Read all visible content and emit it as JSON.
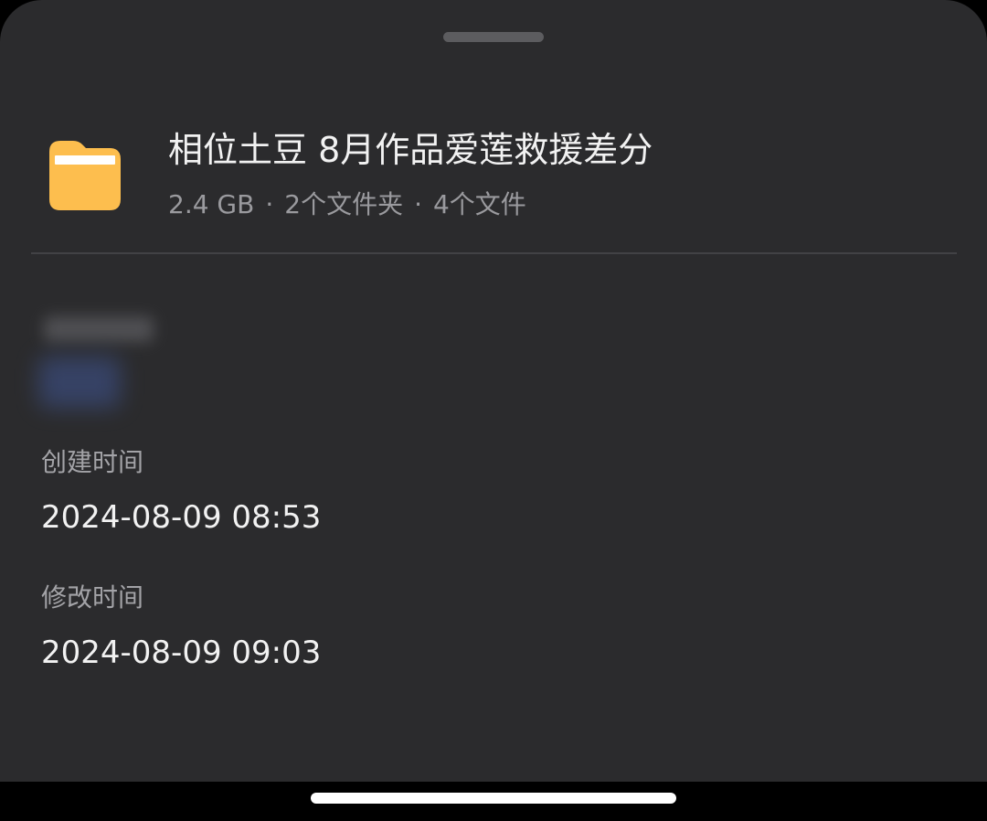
{
  "folder": {
    "icon": "folder-icon",
    "icon_color": "#FDBE4E",
    "name": "相位土豆 8月作品爱莲救援差分",
    "size": "2.4 GB",
    "separator": "·",
    "subfolders": "2个文件夹",
    "files": "4个文件"
  },
  "details": {
    "created_label": "创建时间",
    "created_value": "2024-08-09 08:53",
    "modified_label": "修改时间",
    "modified_value": "2024-08-09 09:03"
  },
  "colors": {
    "sheet_background": "#2B2B2D",
    "primary_text": "#F2F2F2",
    "secondary_text": "#9A9A9E"
  }
}
